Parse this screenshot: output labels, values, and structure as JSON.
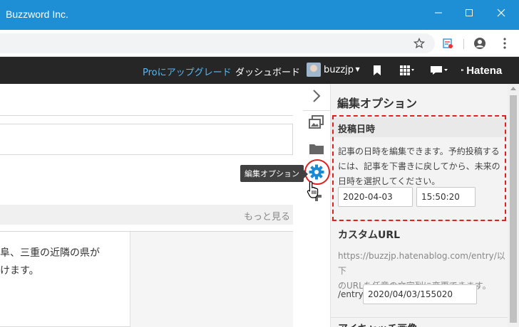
{
  "window": {
    "title": "Buzzword Inc."
  },
  "hatena_bar": {
    "upgrade_link": "Proにアップグレード",
    "dashboard_link": "ダッシュボード",
    "username": "buzzjp",
    "logo_text": "Hatena"
  },
  "editor": {
    "more_link": "もっと見る",
    "text_line1": "阜、三重の近隣の県が",
    "text_line2": "けます。"
  },
  "tooltip": {
    "text": "編集オプション"
  },
  "options_panel": {
    "heading": "編集オプション",
    "post_date": {
      "title": "投稿日時",
      "description_line1": "記事の日時を編集できます。予約投稿する",
      "description_line2": "には、記事を下書きに戻してから、未来の",
      "description_line3": "日時を選択してください。",
      "date_value": "2020-04-03",
      "time_value": "15:50:20"
    },
    "custom_url": {
      "title": "カスタムURL",
      "description_line1": "https://buzzjp.hatenablog.com/entry/以下",
      "description_line2": "のURLを任意の文字列に変更できます。",
      "prefix": "/entry/",
      "value": "2020/04/03/155020"
    },
    "next_section_title": "アイキャッチ画像"
  },
  "colors": {
    "titlebar": "#1e8fd5",
    "hatena_bar": "#262626",
    "pro_link": "#58b8f0",
    "highlight": "#e02020",
    "gear_icon": "#1a8ad4"
  }
}
